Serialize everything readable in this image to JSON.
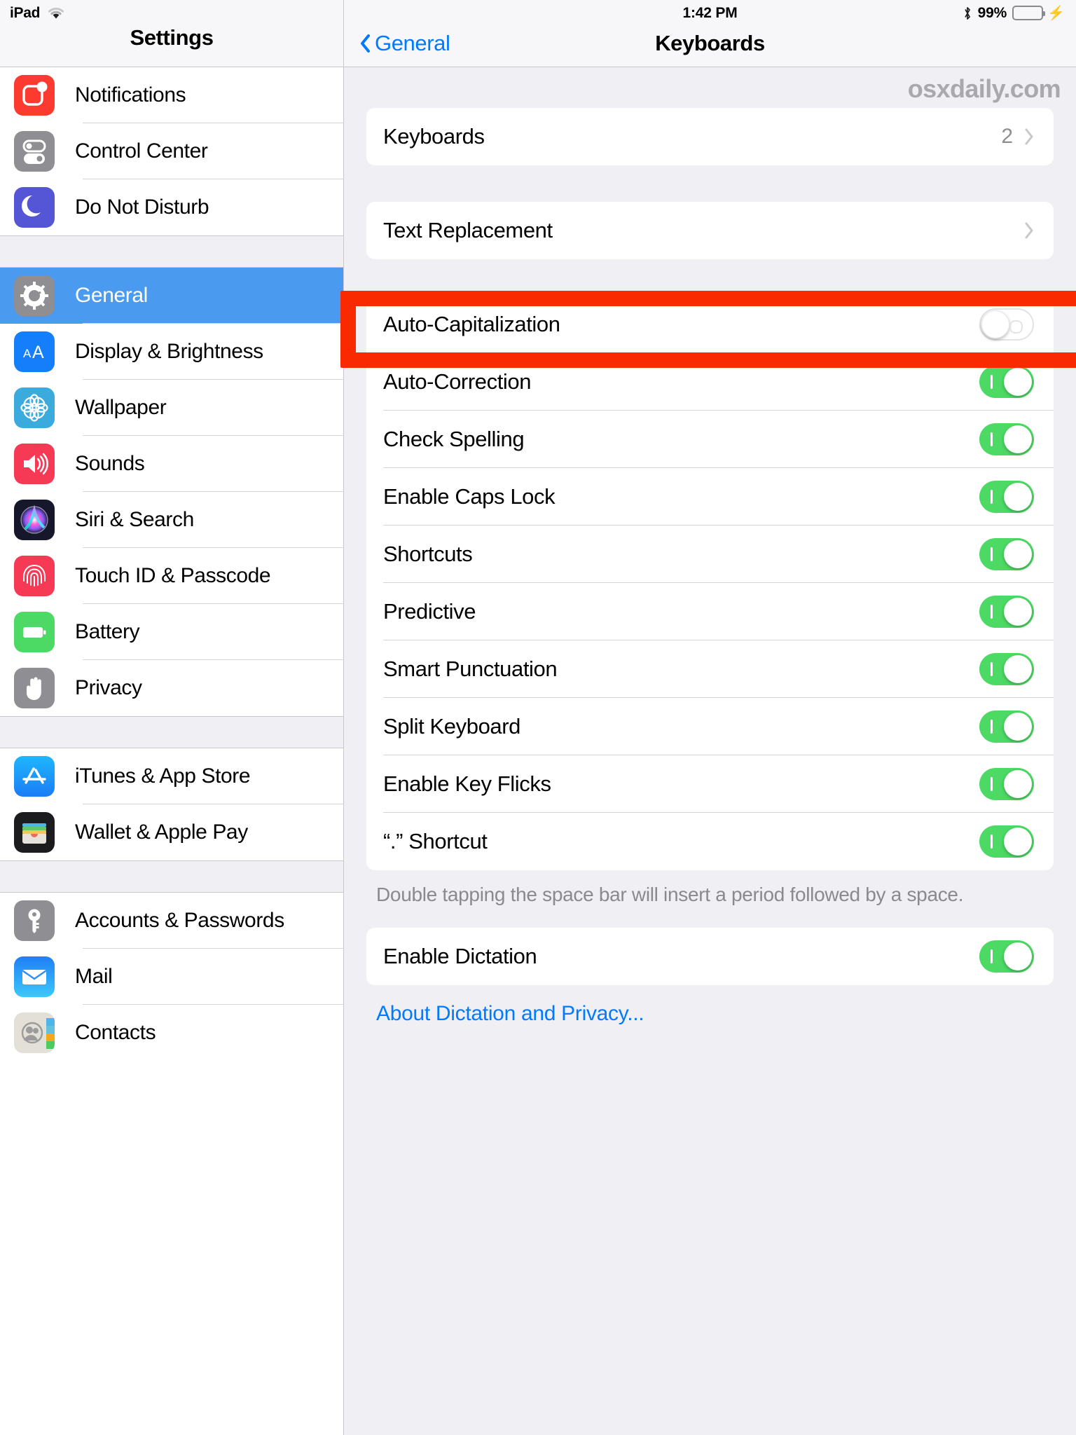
{
  "sidebar": {
    "status": {
      "device": "iPad",
      "wifi_icon": "wifi-icon"
    },
    "title": "Settings",
    "groups": [
      {
        "items": [
          {
            "label": "Notifications",
            "icon": "notifications-icon",
            "selected": false
          },
          {
            "label": "Control Center",
            "icon": "control-center-icon",
            "selected": false
          },
          {
            "label": "Do Not Disturb",
            "icon": "do-not-disturb-icon",
            "selected": false
          }
        ]
      },
      {
        "items": [
          {
            "label": "General",
            "icon": "gear-icon",
            "selected": true
          },
          {
            "label": "Display & Brightness",
            "icon": "display-brightness-icon",
            "selected": false
          },
          {
            "label": "Wallpaper",
            "icon": "wallpaper-icon",
            "selected": false
          },
          {
            "label": "Sounds",
            "icon": "sounds-icon",
            "selected": false
          },
          {
            "label": "Siri & Search",
            "icon": "siri-icon",
            "selected": false
          },
          {
            "label": "Touch ID & Passcode",
            "icon": "touch-id-icon",
            "selected": false
          },
          {
            "label": "Battery",
            "icon": "battery-icon",
            "selected": false
          },
          {
            "label": "Privacy",
            "icon": "privacy-hand-icon",
            "selected": false
          }
        ]
      },
      {
        "items": [
          {
            "label": "iTunes & App Store",
            "icon": "app-store-icon",
            "selected": false
          },
          {
            "label": "Wallet & Apple Pay",
            "icon": "wallet-icon",
            "selected": false
          }
        ]
      },
      {
        "items": [
          {
            "label": "Accounts & Passwords",
            "icon": "key-icon",
            "selected": false
          },
          {
            "label": "Mail",
            "icon": "mail-icon",
            "selected": false
          },
          {
            "label": "Contacts",
            "icon": "contacts-icon",
            "selected": false
          }
        ]
      }
    ]
  },
  "detail": {
    "status": {
      "time": "1:42 PM",
      "bluetooth_icon": "bluetooth-icon",
      "battery_percent": "99%",
      "battery_icon": "battery-charging-icon"
    },
    "nav": {
      "back_label": "General",
      "back_icon": "chevron-left-icon",
      "title": "Keyboards"
    },
    "watermark": "osxdaily.com",
    "card_keyboards": {
      "label": "Keyboards",
      "value": "2",
      "chevron_icon": "chevron-right-icon"
    },
    "card_text_replacement": {
      "label": "Text Replacement",
      "chevron_icon": "chevron-right-icon"
    },
    "toggles": [
      {
        "label": "Auto-Capitalization",
        "state": "off"
      },
      {
        "label": "Auto-Correction",
        "state": "on"
      },
      {
        "label": "Check Spelling",
        "state": "on"
      },
      {
        "label": "Enable Caps Lock",
        "state": "on"
      },
      {
        "label": "Shortcuts",
        "state": "on"
      },
      {
        "label": "Predictive",
        "state": "on"
      },
      {
        "label": "Smart Punctuation",
        "state": "on"
      },
      {
        "label": "Split Keyboard",
        "state": "on"
      },
      {
        "label": "Enable Key Flicks",
        "state": "on"
      },
      {
        "label": "“.” Shortcut",
        "state": "on"
      }
    ],
    "footnote": "Double tapping the space bar will insert a period followed by a space.",
    "dictation": {
      "label": "Enable Dictation",
      "state": "on"
    },
    "dictation_link": "About Dictation and Privacy...",
    "highlight_color": "#fa2a00",
    "accent_color": "#007aff",
    "selection_color": "#4a9aef",
    "toggle_on_color": "#4cd964"
  }
}
